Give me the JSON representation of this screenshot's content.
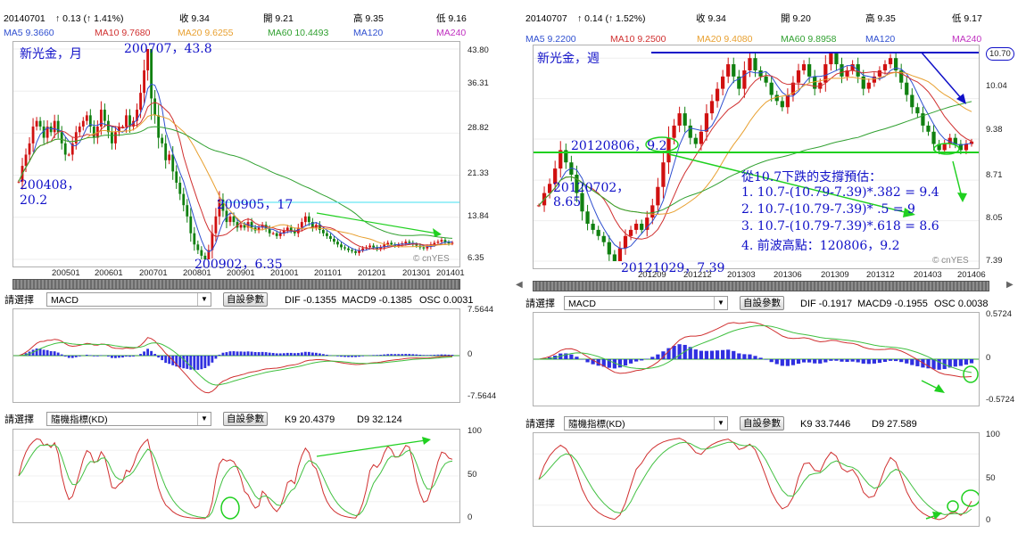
{
  "left": {
    "header": {
      "date": "20140701",
      "change": "↑ 0.13 (↑ 1.41%)",
      "close": "收 9.34",
      "open": "開 9.21",
      "high": "高 9.35",
      "low": "低 9.16"
    },
    "ma": {
      "ma5": "MA5 9.3660",
      "ma10": "MA10 9.7680",
      "ma20": "MA20 9.6255",
      "ma60": "MA60 10.4493",
      "ma120": "MA120",
      "ma240": "MA240"
    },
    "price_ticks": [
      "43.80",
      "36.31",
      "28.82",
      "21.33",
      "13.84",
      "6.35"
    ],
    "x_ticks": [
      "200501",
      "200601",
      "200701",
      "200801",
      "200901",
      "201001",
      "201101",
      "201201",
      "201301",
      "201401"
    ],
    "watermark": "© cnYES",
    "annotations": {
      "title": "新光金，月",
      "peak": "200707，43.8",
      "a2004_1": "200408，",
      "a2004_2": "20.2",
      "a2009_05": "200905，17",
      "a2009_02": "200902，6.35"
    },
    "macd": {
      "select_label": "請選擇",
      "select_value": "MACD",
      "button": "自設參數",
      "dif": "DIF -0.1355",
      "macd9": "MACD9 -0.1385",
      "osc": "OSC 0.0031",
      "ticks": [
        "7.5644",
        "0",
        "-7.5644"
      ]
    },
    "kd": {
      "select_label": "請選擇",
      "select_value": "隨機指標(KD)",
      "button": "自設參數",
      "k9": "K9 20.4379",
      "d9": "D9 32.124",
      "ticks": [
        "100",
        "50",
        "0"
      ]
    }
  },
  "right": {
    "header": {
      "date": "20140707",
      "change": "↑ 0.14 (↑ 1.52%)",
      "close": "收 9.34",
      "open": "開 9.20",
      "high": "高 9.35",
      "low": "低 9.17"
    },
    "ma": {
      "ma5": "MA5 9.2200",
      "ma10": "MA10 9.2500",
      "ma20": "MA20 9.4080",
      "ma60": "MA60 9.8958",
      "ma120": "MA120",
      "ma240": "MA240"
    },
    "price_ticks": [
      "10.70",
      "10.04",
      "9.38",
      "8.71",
      "8.05",
      "7.39"
    ],
    "x_ticks": [
      "201209",
      "201212",
      "201303",
      "201306",
      "201309",
      "201312",
      "201403",
      "201406"
    ],
    "watermark": "© cnYES",
    "annotations": {
      "title": "新光金，週",
      "a0806": "20120806，9.2",
      "a0702_1": "20120702，",
      "a0702_2": "8.65",
      "a1029": "20121029，7.39",
      "note_title": "從10.7下跌的支撐預估：",
      "note1": "1. 10.7-(10.79-7.39)*.382 = 9.4",
      "note2": "2. 10.7-(10.79-7.39)* .5  = 9",
      "note3": "3. 10.7-(10.79-7.39)*.618 = 8.6",
      "note4": "4. 前波高點：120806，9.2"
    },
    "macd": {
      "select_label": "請選擇",
      "select_value": "MACD",
      "button": "自設參數",
      "dif": "DIF -0.1917",
      "macd9": "MACD9 -0.1955",
      "osc": "OSC 0.0038",
      "ticks": [
        "0.5724",
        "0",
        "-0.5724"
      ]
    },
    "kd": {
      "select_label": "請選擇",
      "select_value": "隨機指標(KD)",
      "button": "自設參數",
      "k9": "K9 33.7446",
      "d9": "D9 27.589",
      "ticks": [
        "100",
        "50",
        "0"
      ]
    }
  },
  "colors": {
    "up": "#d01010",
    "down": "#108010",
    "ma5": "#3050d0",
    "ma10": "#d03030",
    "ma20": "#e8a030",
    "ma60": "#30a030",
    "ma120": "#3050d0",
    "ma240": "#c030c0",
    "annot": "#1010c8",
    "green_mark": "#20d020",
    "cyan": "#40e0f0",
    "macd_bar": "#3030e0"
  },
  "chart_data": [
    {
      "type": "candlestick",
      "name": "left-price",
      "ylim": [
        6.35,
        43.8
      ],
      "x_ticks": [
        "200501",
        "200601",
        "200701",
        "200801",
        "200901",
        "201001",
        "201101",
        "201201",
        "201301",
        "201401"
      ],
      "y_ticks": [
        43.8,
        36.31,
        28.82,
        21.33,
        13.84,
        6.35
      ],
      "close": [
        20.2,
        23,
        25,
        27,
        30,
        31,
        30,
        28,
        30,
        29,
        31,
        29,
        27,
        25,
        25,
        27,
        29,
        30,
        31,
        32,
        30,
        28,
        30,
        33,
        31,
        29,
        27,
        29,
        30,
        30,
        32,
        30,
        31,
        33,
        36,
        40,
        43.8,
        35,
        32,
        28,
        27,
        24,
        25,
        22,
        20,
        18,
        16,
        14,
        11,
        9,
        8,
        7,
        6.35,
        8,
        11,
        14,
        17,
        15,
        13,
        14,
        13,
        12,
        12.5,
        12,
        13,
        12,
        11.5,
        12,
        12.5,
        11.8,
        11,
        11,
        10.5,
        11,
        11.5,
        12,
        11.5,
        11,
        12,
        13,
        14,
        13,
        12,
        12.5,
        11.6,
        11,
        10.5,
        10,
        9.5,
        9,
        8.5,
        8.3,
        8,
        7.8,
        7.5,
        8,
        8.3,
        8.5,
        8.8,
        8.5,
        8.2,
        8.5,
        9,
        9.3,
        9,
        8.8,
        9,
        9.2,
        9.5,
        9.3,
        9,
        8.8,
        8.5,
        8.3,
        8.6,
        9,
        9.3,
        9.5,
        9.8,
        9.4,
        9.2,
        9.3
      ],
      "annotations": [
        "200707, 43.8",
        "200408, 20.2",
        "200905, 17",
        "200902, 6.35"
      ]
    },
    {
      "type": "candlestick",
      "name": "right-price",
      "ylim": [
        7.39,
        10.79
      ],
      "x_ticks": [
        "201209",
        "201212",
        "201303",
        "201306",
        "201309",
        "201312",
        "201403",
        "201406"
      ],
      "y_ticks": [
        10.7,
        10.04,
        9.38,
        8.71,
        8.05,
        7.39
      ],
      "close": [
        8.3,
        8.5,
        8.65,
        8.9,
        9.2,
        9.0,
        8.8,
        8.5,
        8.2,
        8.0,
        7.9,
        7.8,
        7.7,
        7.5,
        7.39,
        7.6,
        7.8,
        7.9,
        8.0,
        7.9,
        8.1,
        8.3,
        8.6,
        9.0,
        9.4,
        9.6,
        9.8,
        9.6,
        9.4,
        9.3,
        9.5,
        9.8,
        10.0,
        10.2,
        10.4,
        10.6,
        10.4,
        10.2,
        10.5,
        10.7,
        10.5,
        10.4,
        10.3,
        10.1,
        10.0,
        9.9,
        10.1,
        10.3,
        10.5,
        10.6,
        10.4,
        10.2,
        10.3,
        10.6,
        10.79,
        10.6,
        10.4,
        10.5,
        10.6,
        10.4,
        10.2,
        10.3,
        10.4,
        10.5,
        10.6,
        10.7,
        10.5,
        10.3,
        10.1,
        9.9,
        9.8,
        9.6,
        9.5,
        9.3,
        9.2,
        9.3,
        9.4,
        9.3,
        9.2,
        9.3,
        9.34
      ]
    },
    {
      "type": "line",
      "name": "left-macd",
      "ylim": [
        -7.5644,
        7.5644
      ]
    },
    {
      "type": "line",
      "name": "left-kd",
      "ylim": [
        0,
        100
      ]
    },
    {
      "type": "line",
      "name": "right-macd",
      "ylim": [
        -0.5724,
        0.5724
      ]
    },
    {
      "type": "line",
      "name": "right-kd",
      "ylim": [
        0,
        100
      ]
    }
  ]
}
